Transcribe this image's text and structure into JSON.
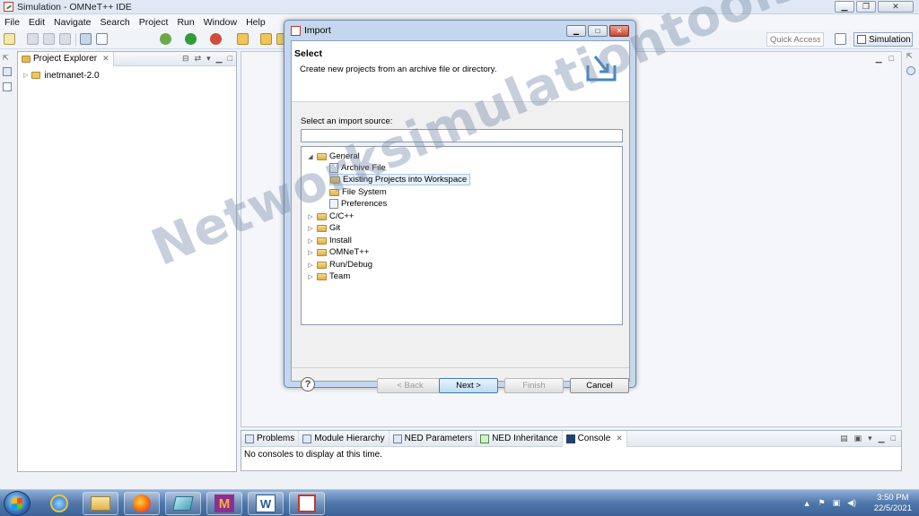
{
  "window": {
    "title": "Simulation - OMNeT++ IDE"
  },
  "menu": [
    "File",
    "Edit",
    "Navigate",
    "Search",
    "Project",
    "Run",
    "Window",
    "Help"
  ],
  "toolbar": {
    "quick_access_placeholder": "Quick Access",
    "perspective_label": "Simulation"
  },
  "explorer": {
    "tab_label": "Project Explorer",
    "items": [
      {
        "label": "inetmanet-2.0"
      }
    ]
  },
  "dialog": {
    "title": "Import",
    "heading": "Select",
    "description": "Create new projects from an archive file or directory.",
    "source_label": "Select an import source:",
    "filter_value": "",
    "tree": {
      "general": {
        "label": "General",
        "children": [
          "Archive File",
          "Existing Projects into Workspace",
          "File System",
          "Preferences"
        ]
      },
      "others": [
        "C/C++",
        "Git",
        "Install",
        "OMNeT++",
        "Run/Debug",
        "Team"
      ]
    },
    "buttons": {
      "back": "< Back",
      "next": "Next >",
      "finish": "Finish",
      "cancel": "Cancel"
    }
  },
  "bottom_panel": {
    "tabs": [
      "Problems",
      "Module Hierarchy",
      "NED Parameters",
      "NED Inheritance",
      "Console"
    ],
    "active_tab": "Console",
    "message": "No consoles to display at this time."
  },
  "watermark": "Networksimulationtools.com",
  "taskbar": {
    "time": "3:50 PM",
    "date": "22/5/2021"
  },
  "colors": {
    "accent": "#3c7fb1",
    "title_bar": "#dfe8f4",
    "dialog_frame": "#c5d7ee",
    "taskbar": "#4f77ab"
  }
}
